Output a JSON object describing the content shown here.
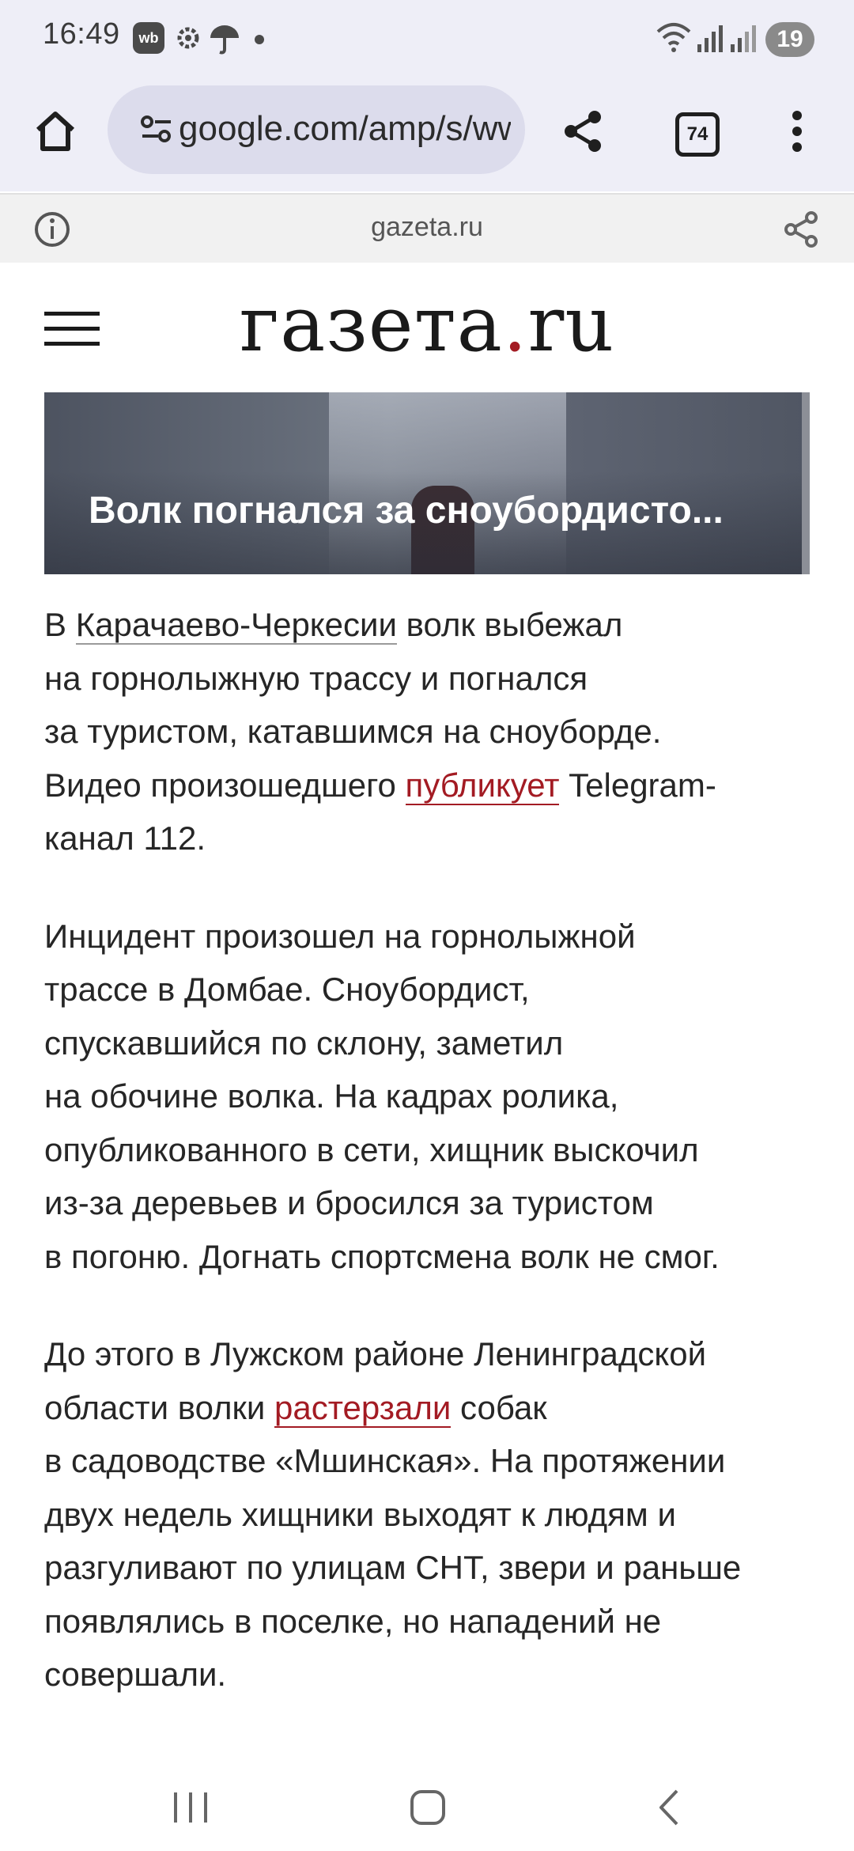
{
  "status_bar": {
    "time": "16:49",
    "wb_label": "wb",
    "battery": "19"
  },
  "browser": {
    "url": "google.com/amp/s/www.gazeta.ru",
    "tab_count": "74"
  },
  "site_info": {
    "domain": "gazeta.ru"
  },
  "site": {
    "logo_main": "газета",
    "logo_dot": ".",
    "logo_tld": "ru"
  },
  "video": {
    "title": "Волк погнался за сноубордисто..."
  },
  "article": {
    "p1": {
      "l1_pre": "В ",
      "l1_link": "Карачаево-Черкесии",
      "l1_post": " волк выбежал",
      "l2": "на горнолыжную трассу и погнался",
      "l3": "за туристом, катавшимся на сноуборде.",
      "l4_pre": "Видео произошедшего ",
      "l4_link": "публикует",
      "l4_post": " Telegram-",
      "l5": "канал 112."
    },
    "p2": {
      "l1": "Инцидент произошел на горнолыжной",
      "l2": "трассе в Домбае. Сноубордист,",
      "l3": "спускавшийся по склону, заметил",
      "l4": "на обочине волка. На кадрах ролика,",
      "l5": "опубликованного в сети, хищник выскочил",
      "l6": "из-за деревьев и бросился за туристом",
      "l7": "в погоню. Догнать спортсмена волк не смог."
    },
    "p3": {
      "l1": "До этого в Лужском районе Ленинградской",
      "l2_pre": "области волки ",
      "l2_link": "растерзали",
      "l2_post": " собак",
      "l3": "в садоводстве «Мшинская». На протяжении",
      "l4": "двух недель хищники выходят к людям и",
      "l5": "разгуливают по улицам СНТ, звери и раньше",
      "l6": "появлялись в поселке, но нападений не",
      "l7": "совершали."
    }
  },
  "icons": {
    "status": [
      "wb-app-icon",
      "settings-icon",
      "umbrella-icon",
      "notification-dot-icon",
      "wifi-icon",
      "signal-icon",
      "battery-icon"
    ],
    "toolbar": [
      "home-icon",
      "site-settings-icon",
      "share-icon",
      "tab-switcher-icon",
      "more-menu-icon"
    ],
    "info_bar": [
      "info-icon",
      "share-icon"
    ],
    "site": [
      "hamburger-menu-icon"
    ],
    "nav": [
      "recent-apps-icon",
      "home-button-icon",
      "back-icon"
    ]
  },
  "colors": {
    "accent_red": "#a31b23",
    "toolbar_bg": "#eeeef7"
  }
}
